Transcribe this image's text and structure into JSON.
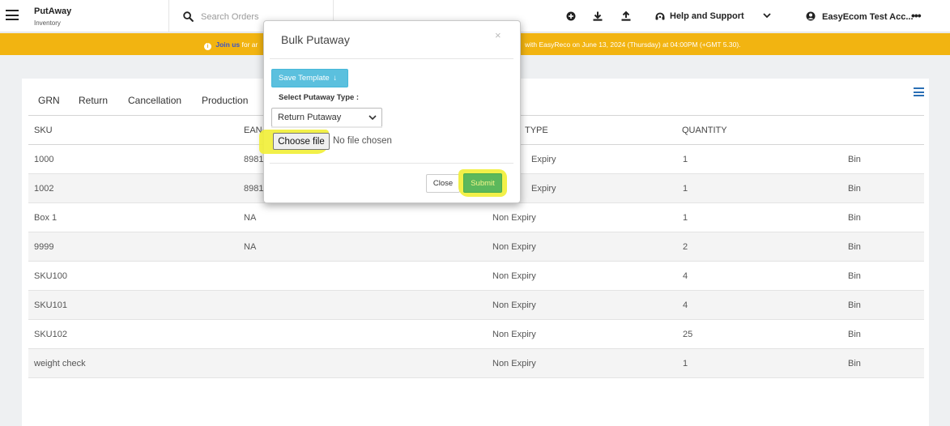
{
  "header": {
    "app_title": "PutAway",
    "app_subtitle": "Inventory",
    "search_placeholder": "Search Orders",
    "help_label": "Help and Support",
    "account_label": "EasyEcom Test Acc...",
    "more_label": "•••",
    "icons": [
      "add-circle-icon",
      "download-icon",
      "upload-icon",
      "headset-icon",
      "chevron-down-icon",
      "user-circle-icon"
    ]
  },
  "banner": {
    "info_glyph": "i",
    "link_text": "Join us",
    "text_left": "for ar",
    "text_right": "with EasyReco on June 13, 2024 (Thursday) at 04:00PM (+GMT 5.30).",
    "color": "#f2b411"
  },
  "tabs": [
    "GRN",
    "Return",
    "Cancellation",
    "Production"
  ],
  "table": {
    "columns": [
      "SKU",
      "EAN/",
      "TYPE",
      "QUANTITY"
    ],
    "rows": [
      {
        "sku": "1000",
        "ean": "8981",
        "type": "Expiry",
        "qty": "1",
        "bin": "Bin"
      },
      {
        "sku": "1002",
        "ean": "8981",
        "type": "Expiry",
        "qty": "1",
        "bin": "Bin"
      },
      {
        "sku": "Box 1",
        "ean": "NA",
        "type": "Non Expiry",
        "qty": "1",
        "bin": "Bin"
      },
      {
        "sku": "9999",
        "ean": "NA",
        "type": "Non Expiry",
        "qty": "2",
        "bin": "Bin"
      },
      {
        "sku": "SKU100",
        "ean": "",
        "type": "Non Expiry",
        "qty": "4",
        "bin": "Bin"
      },
      {
        "sku": "SKU101",
        "ean": "",
        "type": "Non Expiry",
        "qty": "4",
        "bin": "Bin"
      },
      {
        "sku": "SKU102",
        "ean": "",
        "type": "Non Expiry",
        "qty": "25",
        "bin": "Bin"
      },
      {
        "sku": "weight check",
        "ean": "",
        "type": "Non Expiry",
        "qty": "1",
        "bin": "Bin"
      }
    ]
  },
  "modal": {
    "title": "Bulk Putaway",
    "close_glyph": "×",
    "save_template_label": "Save Template",
    "save_template_arrow": "↓",
    "putaway_type_label": "Select Putaway Type :",
    "putaway_type_value": "Return Putaway",
    "choose_file_label": "Choose file",
    "no_file_text": "No file chosen",
    "close_label": "Close",
    "submit_label": "Submit",
    "highlight_color": "#f1ef3a"
  }
}
